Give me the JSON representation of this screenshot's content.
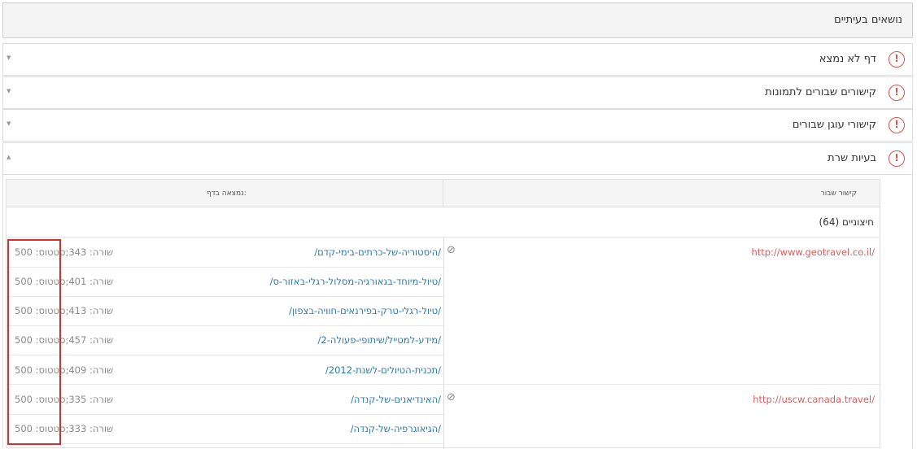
{
  "header": {
    "title": "נושאים בעיתיים"
  },
  "panels": [
    {
      "label": "דף לא נמצא",
      "icon": "!",
      "caret": "▼"
    },
    {
      "label": "קישורים שבורים לתמונות",
      "icon": "!",
      "caret": "▼"
    },
    {
      "label": "קישורי עוגן שבורים",
      "icon": "!",
      "caret": "▼"
    },
    {
      "label": "בעיות שרת",
      "icon": "!",
      "caret": "▲"
    }
  ],
  "table": {
    "col_broken_link": "קישור שבור",
    "col_found_on": "נמצאה בדף:",
    "group_label": "(64) חיצוניים",
    "ban_glyph": "⊘",
    "entries": [
      {
        "url": "http://www.geotravel.co.il/",
        "pages": [
          {
            "path": "/היסטוריה-של-כרתים-בימי-קדם/",
            "meta": "שורה: 343;סטטוס: 500"
          },
          {
            "path": "/טיול-מיוחד-בגאורגיה-מסלול-רגלי-באזור-ס/",
            "meta": "שורה: 401;סטטוס: 500"
          },
          {
            "path": "/טיול-רגלי-טרק-בפירנאים-חוויה-בצפון/",
            "meta": "שורה: 413;סטטוס: 500"
          },
          {
            "path": "/מידע-למטייל/שיתופי-פעולה-2/",
            "meta": "שורה: 457;סטטוס: 500"
          },
          {
            "path": "/תכנית-הטיולים-לשנת-2012/",
            "meta": "שורה: 409;סטטוס: 500"
          }
        ]
      },
      {
        "url": "http://uscw.canada.travel/",
        "pages": [
          {
            "path": "/האינדיאנים-של-קנדה/",
            "meta": "שורה: 335;סטטוס: 500"
          },
          {
            "path": "/הגיאוגרפיה-של-קנדה/",
            "meta": "שורה: 333;סטטוס: 500"
          }
        ]
      }
    ]
  },
  "colors": {
    "alert": "#d9534f",
    "link": "#2a7ab0",
    "broken_link": "#e05a5a",
    "highlight_box": "#d32f2f"
  }
}
